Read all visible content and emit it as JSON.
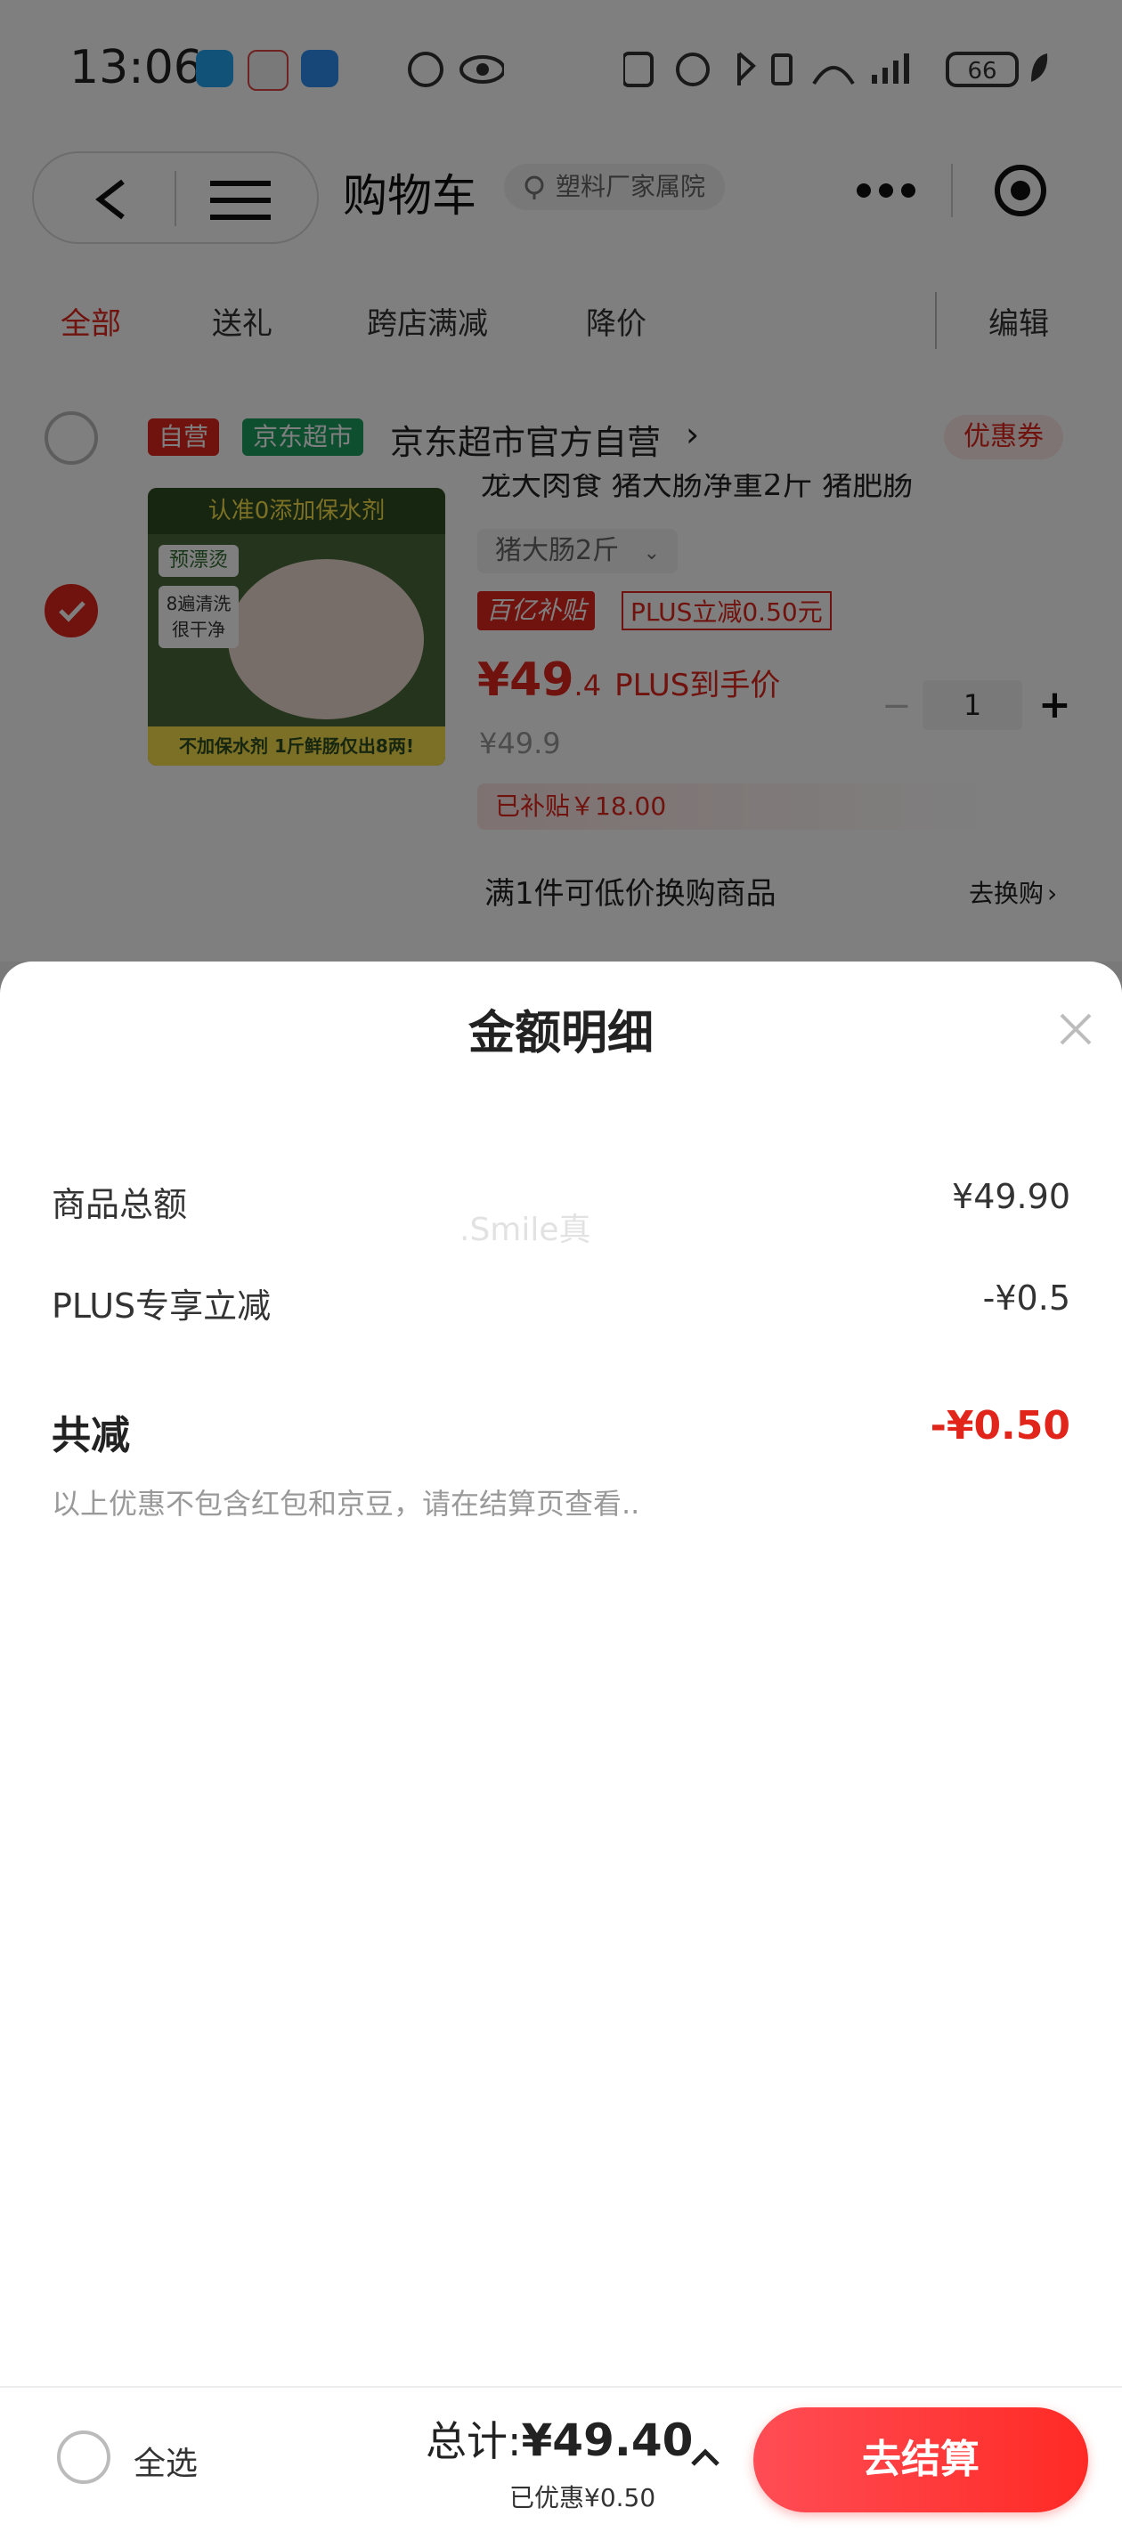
{
  "status_bar": {
    "time": "13:06",
    "battery": "66"
  },
  "header": {
    "title": "购物车",
    "location": "塑料厂家属院"
  },
  "tabs": [
    {
      "label": "全部",
      "active": true
    },
    {
      "label": "送礼",
      "active": false
    },
    {
      "label": "跨店满减",
      "active": false
    },
    {
      "label": "降价",
      "active": false
    }
  ],
  "edit_label": "编辑",
  "store": {
    "tag_self": "自营",
    "tag_market": "京东超市",
    "name": "京东超市官方自营",
    "coupon_label": "优惠券",
    "item": {
      "title_fragment": "龙大肉食 猪大肠净重2斤 猪肥肠",
      "spec": "猪大肠2斤",
      "subsidy_tag": "百亿补贴",
      "plus_tag": "PLUS立减0.50元",
      "price_main": "¥49",
      "price_decimal": ".4",
      "price_note": "PLUS到手价",
      "price_original": "¥49.9",
      "quantity": "1",
      "subsidy_note": "已补贴￥18.00",
      "image_banner_top": "认准0添加保水剂",
      "image_banner_bottom": "不加保水剂 1斤鲜肠仅出8两!",
      "image_badge_1": "预漂烫",
      "image_badge_2": "8遍清洗 很干净"
    },
    "exchange_label": "满1件可低价换购商品",
    "exchange_action": "去换购"
  },
  "modal": {
    "title": "金额明细",
    "rows": [
      {
        "label": "商品总额",
        "value": "¥49.90"
      },
      {
        "label": "PLUS专享立减",
        "value": "-¥0.5"
      }
    ],
    "total_label": "共减",
    "total_value": "-¥0.50",
    "note": "以上优惠不包含红包和京豆，请在结算页查看..",
    "watermark": ".Smile真"
  },
  "bottom": {
    "select_all": "全选",
    "total_prefix": "总计:",
    "total_amount": "¥49.40",
    "saved": "已优惠¥0.50",
    "checkout": "去结算"
  },
  "colors": {
    "accent": "#e1251b",
    "market_green": "#1a9e5f"
  }
}
